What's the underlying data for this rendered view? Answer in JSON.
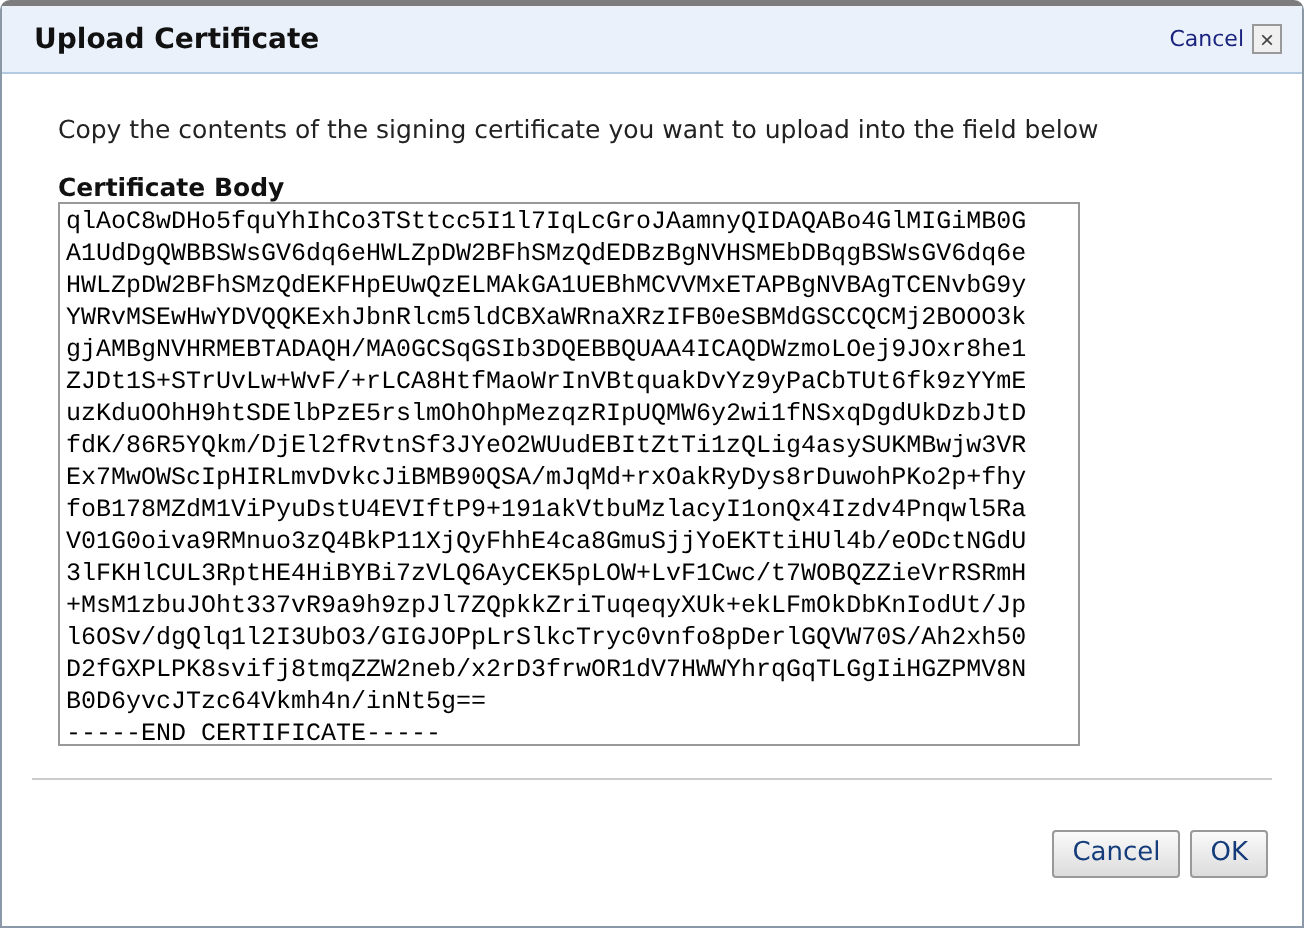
{
  "dialog": {
    "title": "Upload Certificate",
    "cancel_link": "Cancel",
    "close_icon": "×"
  },
  "instructions": "Copy the contents of the signing certificate you want to upload into the field below",
  "certificate_body": {
    "label": "Certificate Body",
    "lines": [
      "qlAoC8wDHo5fquYhIhCo3TSttcc5I1l7IqLcGroJAamnyQIDAQABo4GlMIGiMB0G",
      "A1UdDgQWBBSWsGV6dq6eHWLZpDW2BFhSMzQdEDBzBgNVHSMEbDBqgBSWsGV6dq6e",
      "HWLZpDW2BFhSMzQdEKFHpEUwQzELMAkGA1UEBhMCVVMxETAPBgNVBAgTCENvbG9y",
      "YWRvMSEwHwYDVQQKExhJbnRlcm5ldCBXaWRnaXRzIFB0eSBMdGSCCQCMj2BOOO3k",
      "gjAMBgNVHRMEBTADAQH/MA0GCSqGSIb3DQEBBQUAA4ICAQDWzmoLOej9JOxr8he1",
      "ZJDt1S+STrUvLw+WvF/+rLCA8HtfMaoWrInVBtquakDvYz9yPaCbTUt6fk9zYYmE",
      "uzKduOOhH9htSDElbPzE5rslmOhOhpMezqzRIpUQMW6y2wi1fNSxqDgdUkDzbJtD",
      "fdK/86R5YQkm/DjEl2fRvtnSf3JYeO2WUudEBItZtTi1zQLig4asySUKMBwjw3VR",
      "Ex7MwOWScIpHIRLmvDvkcJiBMB90QSA/mJqMd+rxOakRyDys8rDuwohPKo2p+fhy",
      "foB178MZdM1ViPyuDstU4EVIftP9+191akVtbuMzlacyI1onQx4Izdv4Pnqwl5Ra",
      "V01G0oiva9RMnuo3zQ4BkP11XjQyFhhE4ca8GmuSjjYoEKTtiHUl4b/eODctNGdU",
      "3lFKHlCUL3RptHE4HiBYBi7zVLQ6AyCEK5pLOW+LvF1Cwc/t7WOBQZZieVrRSRmH",
      "+MsM1zbuJOht337vR9a9h9zpJl7ZQpkkZriTuqeqyXUk+ekLFmOkDbKnIodUt/Jp",
      "l6OSv/dgQlq1l2I3UbO3/GIGJOPpLrSlkcTryc0vnfo8pDerlGQVW70S/Ah2xh50",
      "D2fGXPLPK8svifj8tmqZZW2neb/x2rD3frwOR1dV7HWWYhrqGqTLGgIiHGZPMV8N",
      "B0D6yvcJTzc64Vkmh4n/inNt5g==",
      "-----END CERTIFICATE-----"
    ]
  },
  "buttons": [
    "Cancel",
    "OK"
  ]
}
